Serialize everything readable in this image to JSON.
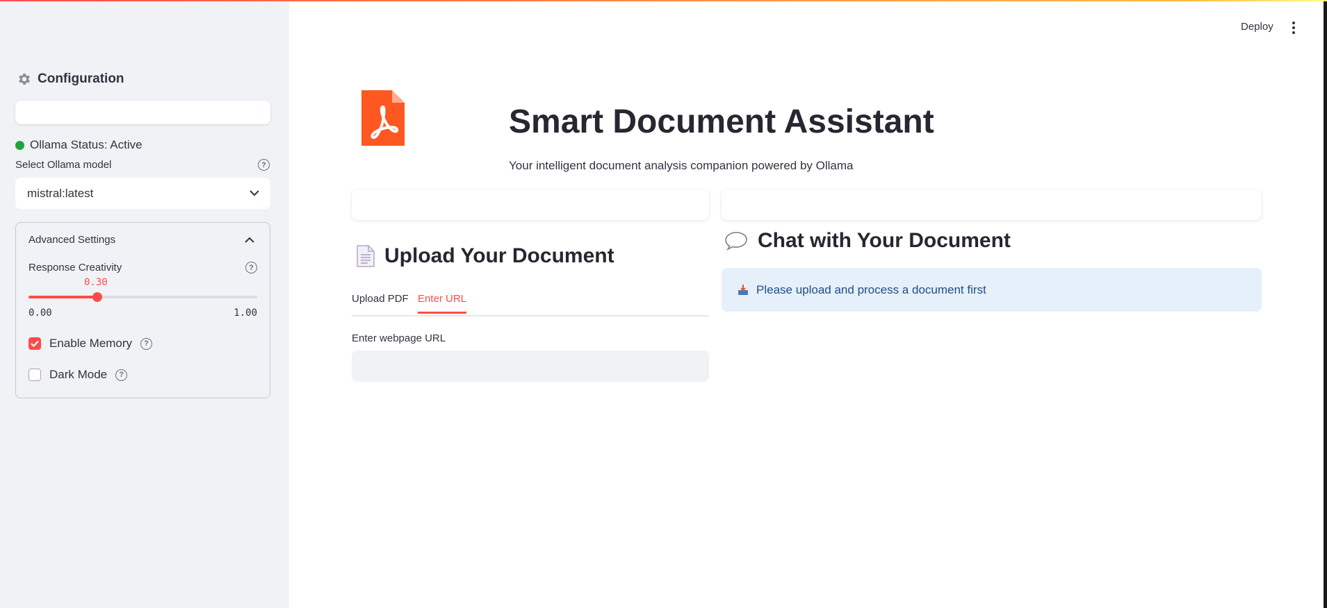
{
  "header": {
    "deploy_label": "Deploy",
    "menu_icon": "kebab-menu-icon"
  },
  "sidebar": {
    "title": "Configuration",
    "title_icon": "gear-icon",
    "status_text": "Ollama Status: Active",
    "status_color": "#21a33a",
    "model_label": "Select Ollama model",
    "model_value": "mistral:latest",
    "advanced": {
      "title": "Advanced Settings",
      "creativity_label": "Response Creativity",
      "creativity_value": "0.30",
      "creativity_fraction": 0.3,
      "creativity_min": "0.00",
      "creativity_max": "1.00",
      "memory_label": "Enable Memory",
      "memory_checked": true,
      "dark_mode_label": "Dark Mode",
      "dark_mode_checked": false
    }
  },
  "main": {
    "logo_icon": "pdf-icon",
    "title": "Smart Document Assistant",
    "subtitle": "Your intelligent document analysis companion powered by Ollama",
    "upload": {
      "heading": "Upload Your Document",
      "tabs": [
        "Upload PDF",
        "Enter URL"
      ],
      "active_tab": "Enter URL",
      "url_label": "Enter webpage URL",
      "url_value": ""
    },
    "chat": {
      "heading": "Chat with Your Document",
      "info_text": "Please upload and process a document first"
    }
  },
  "colors": {
    "accent": "#ff4b4b",
    "sidebar_bg": "#f0f2f6",
    "info_bg": "#e6f0fa",
    "info_text": "#1b4f83",
    "pdf_orange": "#ff5722"
  }
}
